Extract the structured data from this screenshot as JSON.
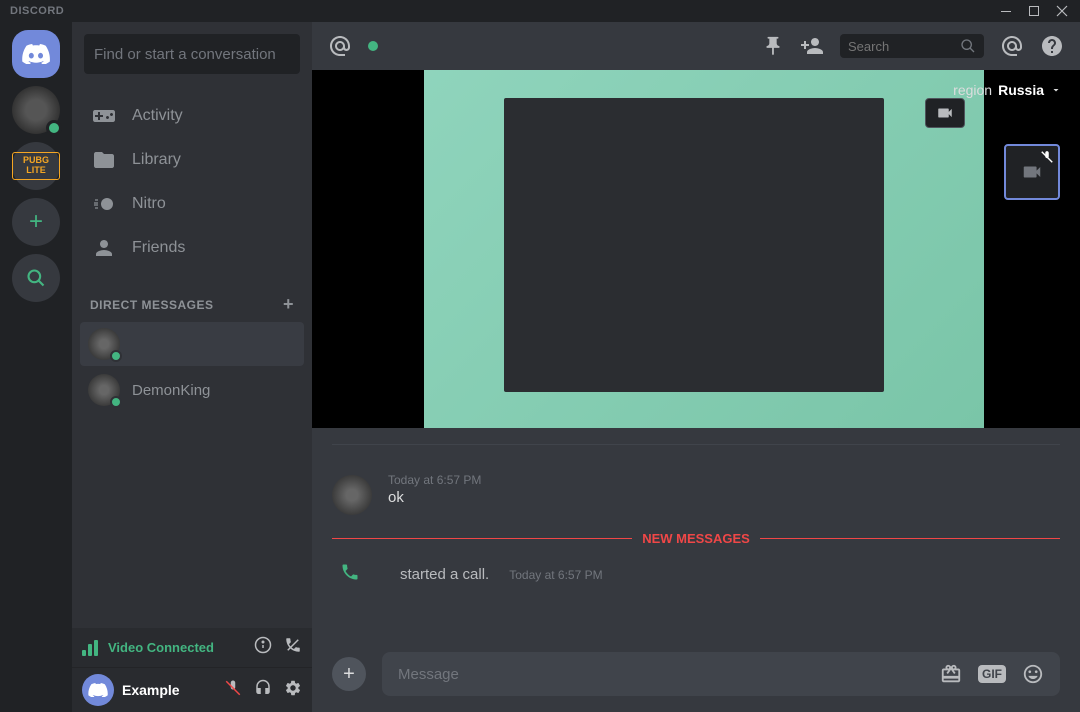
{
  "titlebar": {
    "title": "DISCORD"
  },
  "sidebar": {
    "search_placeholder": "Find or start a conversation",
    "nav": [
      {
        "label": "Activity"
      },
      {
        "label": "Library"
      },
      {
        "label": "Nitro"
      },
      {
        "label": "Friends"
      }
    ],
    "dm_header": "DIRECT MESSAGES",
    "dms": [
      {
        "name": ""
      },
      {
        "name": "DemonKing"
      }
    ]
  },
  "servers": {
    "pubg_label": "PUBG LITE"
  },
  "voice": {
    "status": "Video Connected"
  },
  "user": {
    "name": "Example"
  },
  "header": {
    "search_placeholder": "Search",
    "region_label": "region",
    "region_value": "Russia"
  },
  "messages": {
    "msg1_time": "Today at 6:57 PM",
    "msg1_text": "ok",
    "divider": "NEW MESSAGES",
    "call_text": "started a call.",
    "call_time": "Today at 6:57 PM"
  },
  "composer": {
    "placeholder": "Message",
    "gif_label": "GIF"
  }
}
